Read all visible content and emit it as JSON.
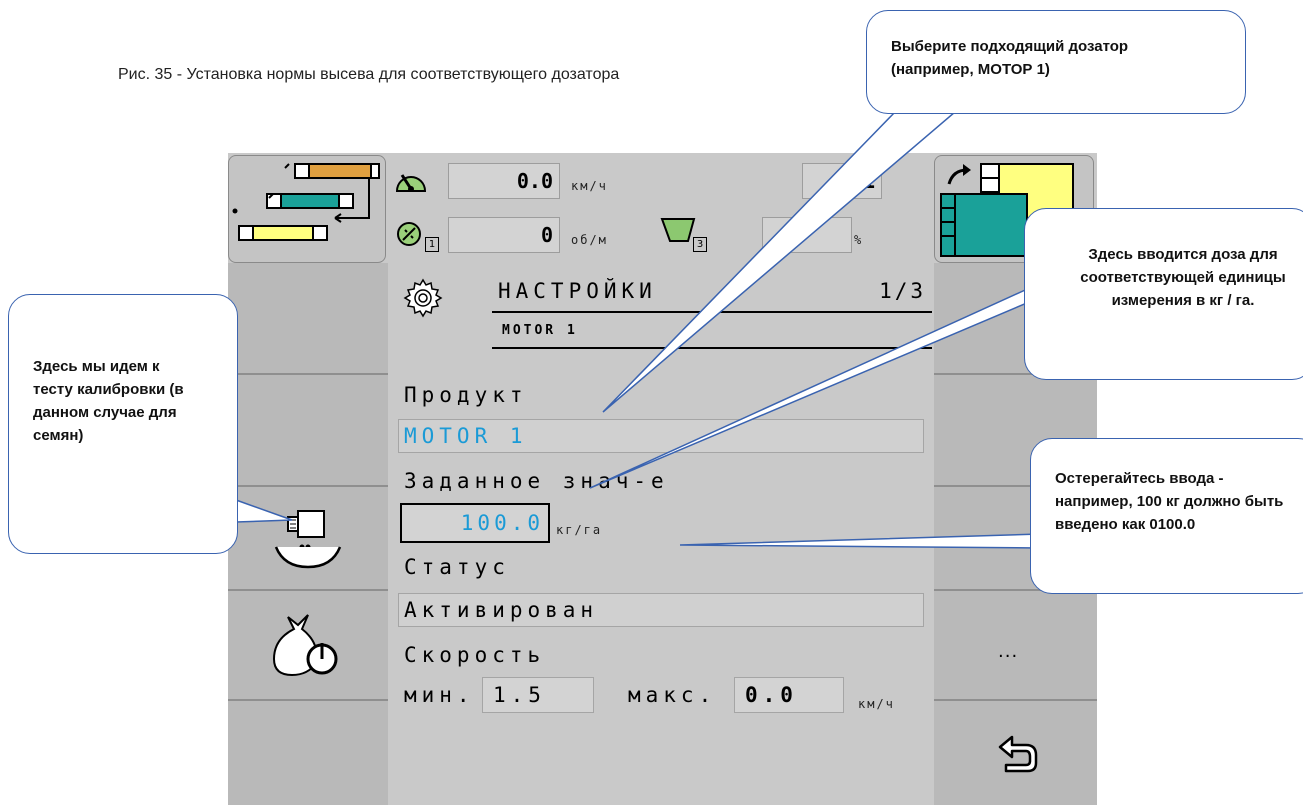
{
  "caption": "Рис. 35 - Установка нормы высева для соответствующего дозатора",
  "topbar": {
    "speed_value": "0.0",
    "speed_unit": "км/ч",
    "rpm_value": "0",
    "rpm_unit": "об/м",
    "counter_partial": "1",
    "percent_unit": "%",
    "sensor_index_1": "1",
    "hopper_index": "3",
    "icons": [
      "speedometer-icon",
      "rpm-sensor-icon",
      "hopper-icon",
      "section-map-icon",
      "tramline-map-icon"
    ]
  },
  "header": {
    "title": "НАСТРОЙКИ",
    "page": "1/3",
    "subtitle": "MOTOR 1"
  },
  "form": {
    "product_label": "Продукт",
    "product_value": "MOTOR 1",
    "target_label": "Заданное знач-е",
    "target_value": "100.0",
    "target_unit": "кг/га",
    "status_label": "Статус",
    "status_value": "Активирован",
    "speed_label": "Скорость",
    "min_label": "мин.",
    "min_value": "1.5",
    "max_label": "макс.",
    "max_value": "0.0",
    "speed_unit": "км/ч"
  },
  "right_sidebar": {
    "more_label": "..."
  },
  "callouts": {
    "select_dispenser": "Выберите подходящий дозатор (например, МОТОР 1)",
    "dose_entry": "Здесь вводится доза для соответствующей единицы измерения в кг / га.",
    "calibration_test": "Здесь мы идем к тесту калибровки (в данном случае для семян)",
    "input_warning": "Остерегайтесь ввода - например, 100 кг должно быть введено как 0100.0"
  },
  "colors": {
    "screen_bg": "#c9c9c9",
    "value_blue": "#1a9ad6",
    "callout_border": "#3a63b0",
    "section_teal": "#1aa199",
    "section_yellow": "#ffff80",
    "section_orange": "#e0a040",
    "hopper_green": "#8cc870"
  }
}
